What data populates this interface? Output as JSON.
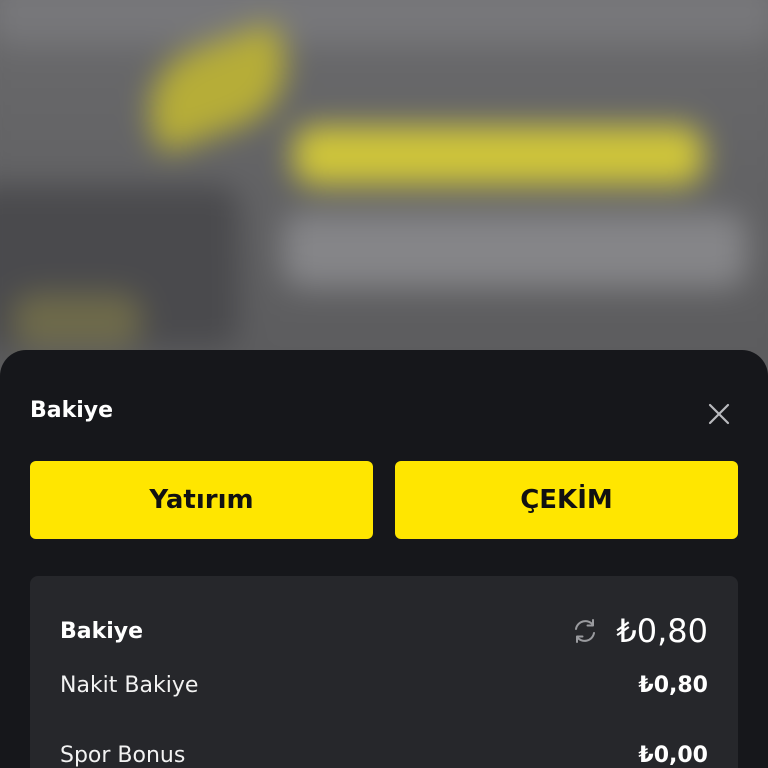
{
  "sheet": {
    "title": "Bakiye"
  },
  "actions": {
    "deposit_label": "Yatırım",
    "withdraw_label": "ÇEKİM"
  },
  "balance": {
    "main_label": "Bakiye",
    "main_amount": "₺0,80",
    "rows": [
      {
        "label": "Nakit Bakiye",
        "amount": "₺0,80"
      },
      {
        "label": "Spor Bonus",
        "amount": "₺0,00"
      }
    ]
  },
  "icons": {
    "close": "close-icon",
    "refresh": "refresh-icon"
  },
  "colors": {
    "accent": "#ffe600",
    "sheet_bg": "#16171b",
    "card_bg": "#26272b",
    "text": "#ffffff"
  }
}
